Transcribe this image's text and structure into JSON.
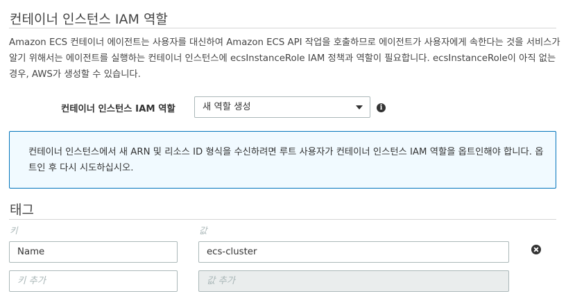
{
  "iam_section": {
    "title": "컨테이너 인스턴스 IAM 역할",
    "description": "Amazon ECS 컨테이너 에이전트는 사용자를 대신하여 Amazon ECS API 작업을 호출하므로 에이전트가 사용자에게 속한다는 것을 서비스가 알기 위해서는 에이전트를 실행하는 컨테이너 인스턴스에 ecsInstanceRole IAM 정책과 역할이 필요합니다. ecsInstanceRole이 아직 없는 경우, AWS가 생성할 수 있습니다.",
    "role_field": {
      "label": "컨테이너 인스턴스 IAM 역할",
      "selected_value": "새 역할 생성",
      "info_icon": "info-icon"
    },
    "info_box_text": "컨테이너 인스턴스에서 새 ARN 및 리소스 ID 형식을 수신하려면 루트 사용자가 컨테이너 인스턴스 IAM 역할을 옵트인해야 합니다. 옵트인 후 다시 시도하십시오."
  },
  "tags_section": {
    "title": "태그",
    "key_header": "키",
    "value_header": "값",
    "rows": [
      {
        "key": "Name",
        "value": "ecs-cluster"
      }
    ],
    "new_row": {
      "key_placeholder": "키 추가",
      "value_placeholder": "값 추가"
    },
    "remove_icon": "remove-circle-icon"
  },
  "colors": {
    "info_border": "#0073bb",
    "info_bg": "#f1faff",
    "muted": "#aab7b8"
  }
}
